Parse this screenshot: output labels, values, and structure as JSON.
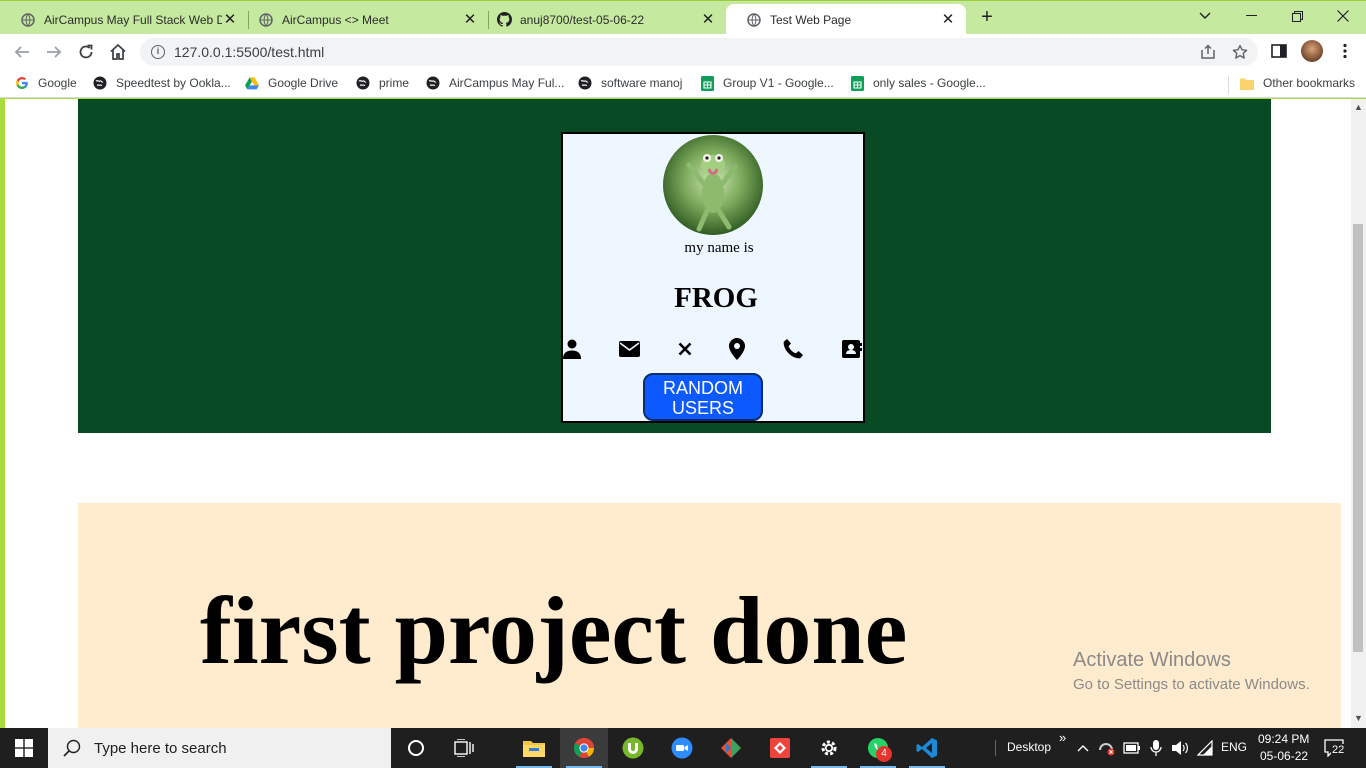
{
  "browser": {
    "tabs": [
      {
        "title": "AirCampus May Full Stack Web D",
        "icon": "globe-icon",
        "active": false
      },
      {
        "title": "AirCampus <> Meet",
        "icon": "globe-icon",
        "active": false
      },
      {
        "title": "anuj8700/test-05-06-22",
        "icon": "github-icon",
        "active": false
      },
      {
        "title": "Test Web Page",
        "icon": "globe-icon",
        "active": true
      }
    ],
    "close_glyph": "✕",
    "new_tab_glyph": "+",
    "url": "127.0.0.1:5500/test.html",
    "bookmarks": [
      {
        "label": "Google",
        "icon": "google-icon"
      },
      {
        "label": "Speedtest by Ookla...",
        "icon": "globe-icon"
      },
      {
        "label": "Google Drive",
        "icon": "drive-icon"
      },
      {
        "label": "prime",
        "icon": "globe-icon"
      },
      {
        "label": "AirCampus May Ful...",
        "icon": "globe-icon"
      },
      {
        "label": "software manoj",
        "icon": "globe-icon"
      },
      {
        "label": "Group V1 - Google...",
        "icon": "sheets-icon"
      },
      {
        "label": "only sales - Google...",
        "icon": "sheets-icon"
      }
    ],
    "other_bookmarks": "Other bookmarks"
  },
  "page": {
    "card": {
      "subtitle": "my name is",
      "name": "FROG",
      "icons": [
        "user-icon",
        "envelope-icon",
        "x-icon",
        "map-pin-icon",
        "phone-icon",
        "address-card-icon"
      ],
      "button_label": "RANDOM USERS"
    },
    "heading": "first project done"
  },
  "watermark": {
    "line1": "Activate Windows",
    "line2": "Go to Settings to activate Windows."
  },
  "taskbar": {
    "search_placeholder": "Type here to search",
    "desktop_label": "Desktop",
    "chevron": "»",
    "language": "ENG",
    "time": "09:24 PM",
    "date": "05-06-22",
    "whatsapp_badge": "4",
    "notification_count": "22"
  },
  "colors": {
    "green_block": "#084a24",
    "peach": "#ffebcd",
    "button_blue": "#0c5aff",
    "frame": "#c6e9a0"
  }
}
